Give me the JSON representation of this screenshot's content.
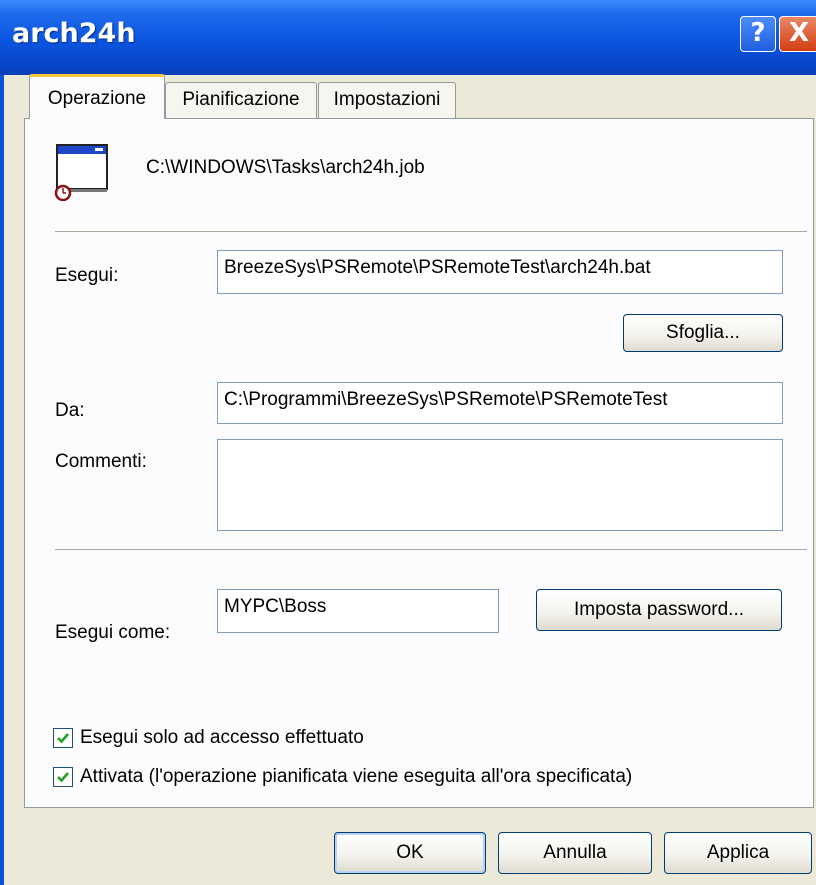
{
  "window": {
    "title": "arch24h"
  },
  "titlebar": {
    "help_glyph": "?",
    "close_glyph": "X"
  },
  "tabs": [
    {
      "label": "Operazione"
    },
    {
      "label": "Pianificazione"
    },
    {
      "label": "Impostazioni"
    }
  ],
  "task": {
    "path": "C:\\WINDOWS\\Tasks\\arch24h.job",
    "icon": "scheduled-task-icon"
  },
  "form": {
    "run_label": "Esegui:",
    "run_value": "BreezeSys\\PSRemote\\PSRemoteTest\\arch24h.bat",
    "browse_label": "Sfoglia...",
    "start_in_label": "Da:",
    "start_in_value": "C:\\Programmi\\BreezeSys\\PSRemote\\PSRemoteTest",
    "comments_label": "Commenti:",
    "comments_value": "",
    "run_as_label": "Esegui come:",
    "run_as_value": "MYPC\\Boss",
    "set_password_label": "Imposta password..."
  },
  "options": [
    {
      "label": "Esegui solo ad accesso effettuato",
      "checked": true
    },
    {
      "label": "Attivata (l'operazione pianificata viene eseguita all'ora specificata)",
      "checked": true
    }
  ],
  "footer": {
    "ok_label": "OK",
    "cancel_label": "Annulla",
    "apply_label": "Applica"
  },
  "colors": {
    "titlebar": "#0A54E0",
    "dialog_bg": "#ECE9D8",
    "tab_accent": "#FFC83C",
    "check": "#21A121"
  }
}
